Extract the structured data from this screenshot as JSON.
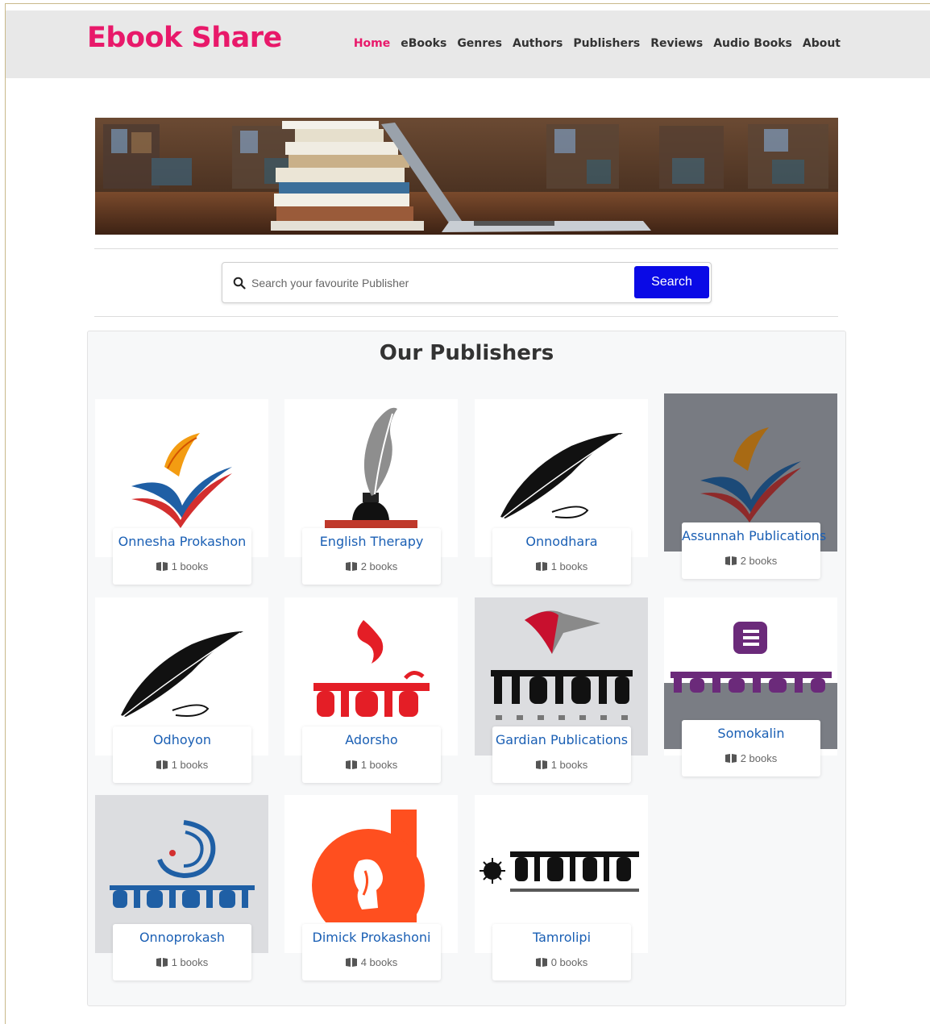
{
  "brand": "Ebook Share",
  "nav": [
    {
      "label": "Home",
      "active": true
    },
    {
      "label": "eBooks"
    },
    {
      "label": "Genres"
    },
    {
      "label": "Authors"
    },
    {
      "label": "Publishers"
    },
    {
      "label": "Reviews"
    },
    {
      "label": "Audio Books"
    },
    {
      "label": "About"
    }
  ],
  "search": {
    "placeholder": "Search your favourite Publisher",
    "button": "Search"
  },
  "section_title": "Our Publishers",
  "colors": {
    "brand": "#e8196a",
    "link": "#1a5fb4",
    "search_button": "#0a0ae6",
    "nav_bg": "#e8e8e8"
  },
  "publishers": [
    {
      "name": "Onnesha Prokashon",
      "count": "1 books",
      "logo": "quill-book-logo"
    },
    {
      "name": "English Therapy",
      "count": "2 books",
      "logo": "quill-inkpot-logo"
    },
    {
      "name": "Onnodhara",
      "count": "1 books",
      "logo": "black-feather-logo"
    },
    {
      "name": "Assunnah Publications",
      "count": "2 books",
      "logo": "quill-book-logo"
    },
    {
      "name": "Odhoyon",
      "count": "1 books",
      "logo": "black-feather-logo"
    },
    {
      "name": "Adorsho",
      "count": "1 books",
      "logo": "adorsho-logo"
    },
    {
      "name": "Gardian Publications",
      "count": "1 books",
      "logo": "guardian-logo"
    },
    {
      "name": "Somokalin",
      "count": "2 books",
      "logo": "somokalin-logo"
    },
    {
      "name": "Onnoprokash",
      "count": "1 books",
      "logo": "onnoprokash-logo"
    },
    {
      "name": "Dimick Prokashoni",
      "count": "4 books",
      "logo": "dimick-logo"
    },
    {
      "name": "Tamrolipi",
      "count": "0 books",
      "logo": "tamrolipi-logo"
    }
  ]
}
